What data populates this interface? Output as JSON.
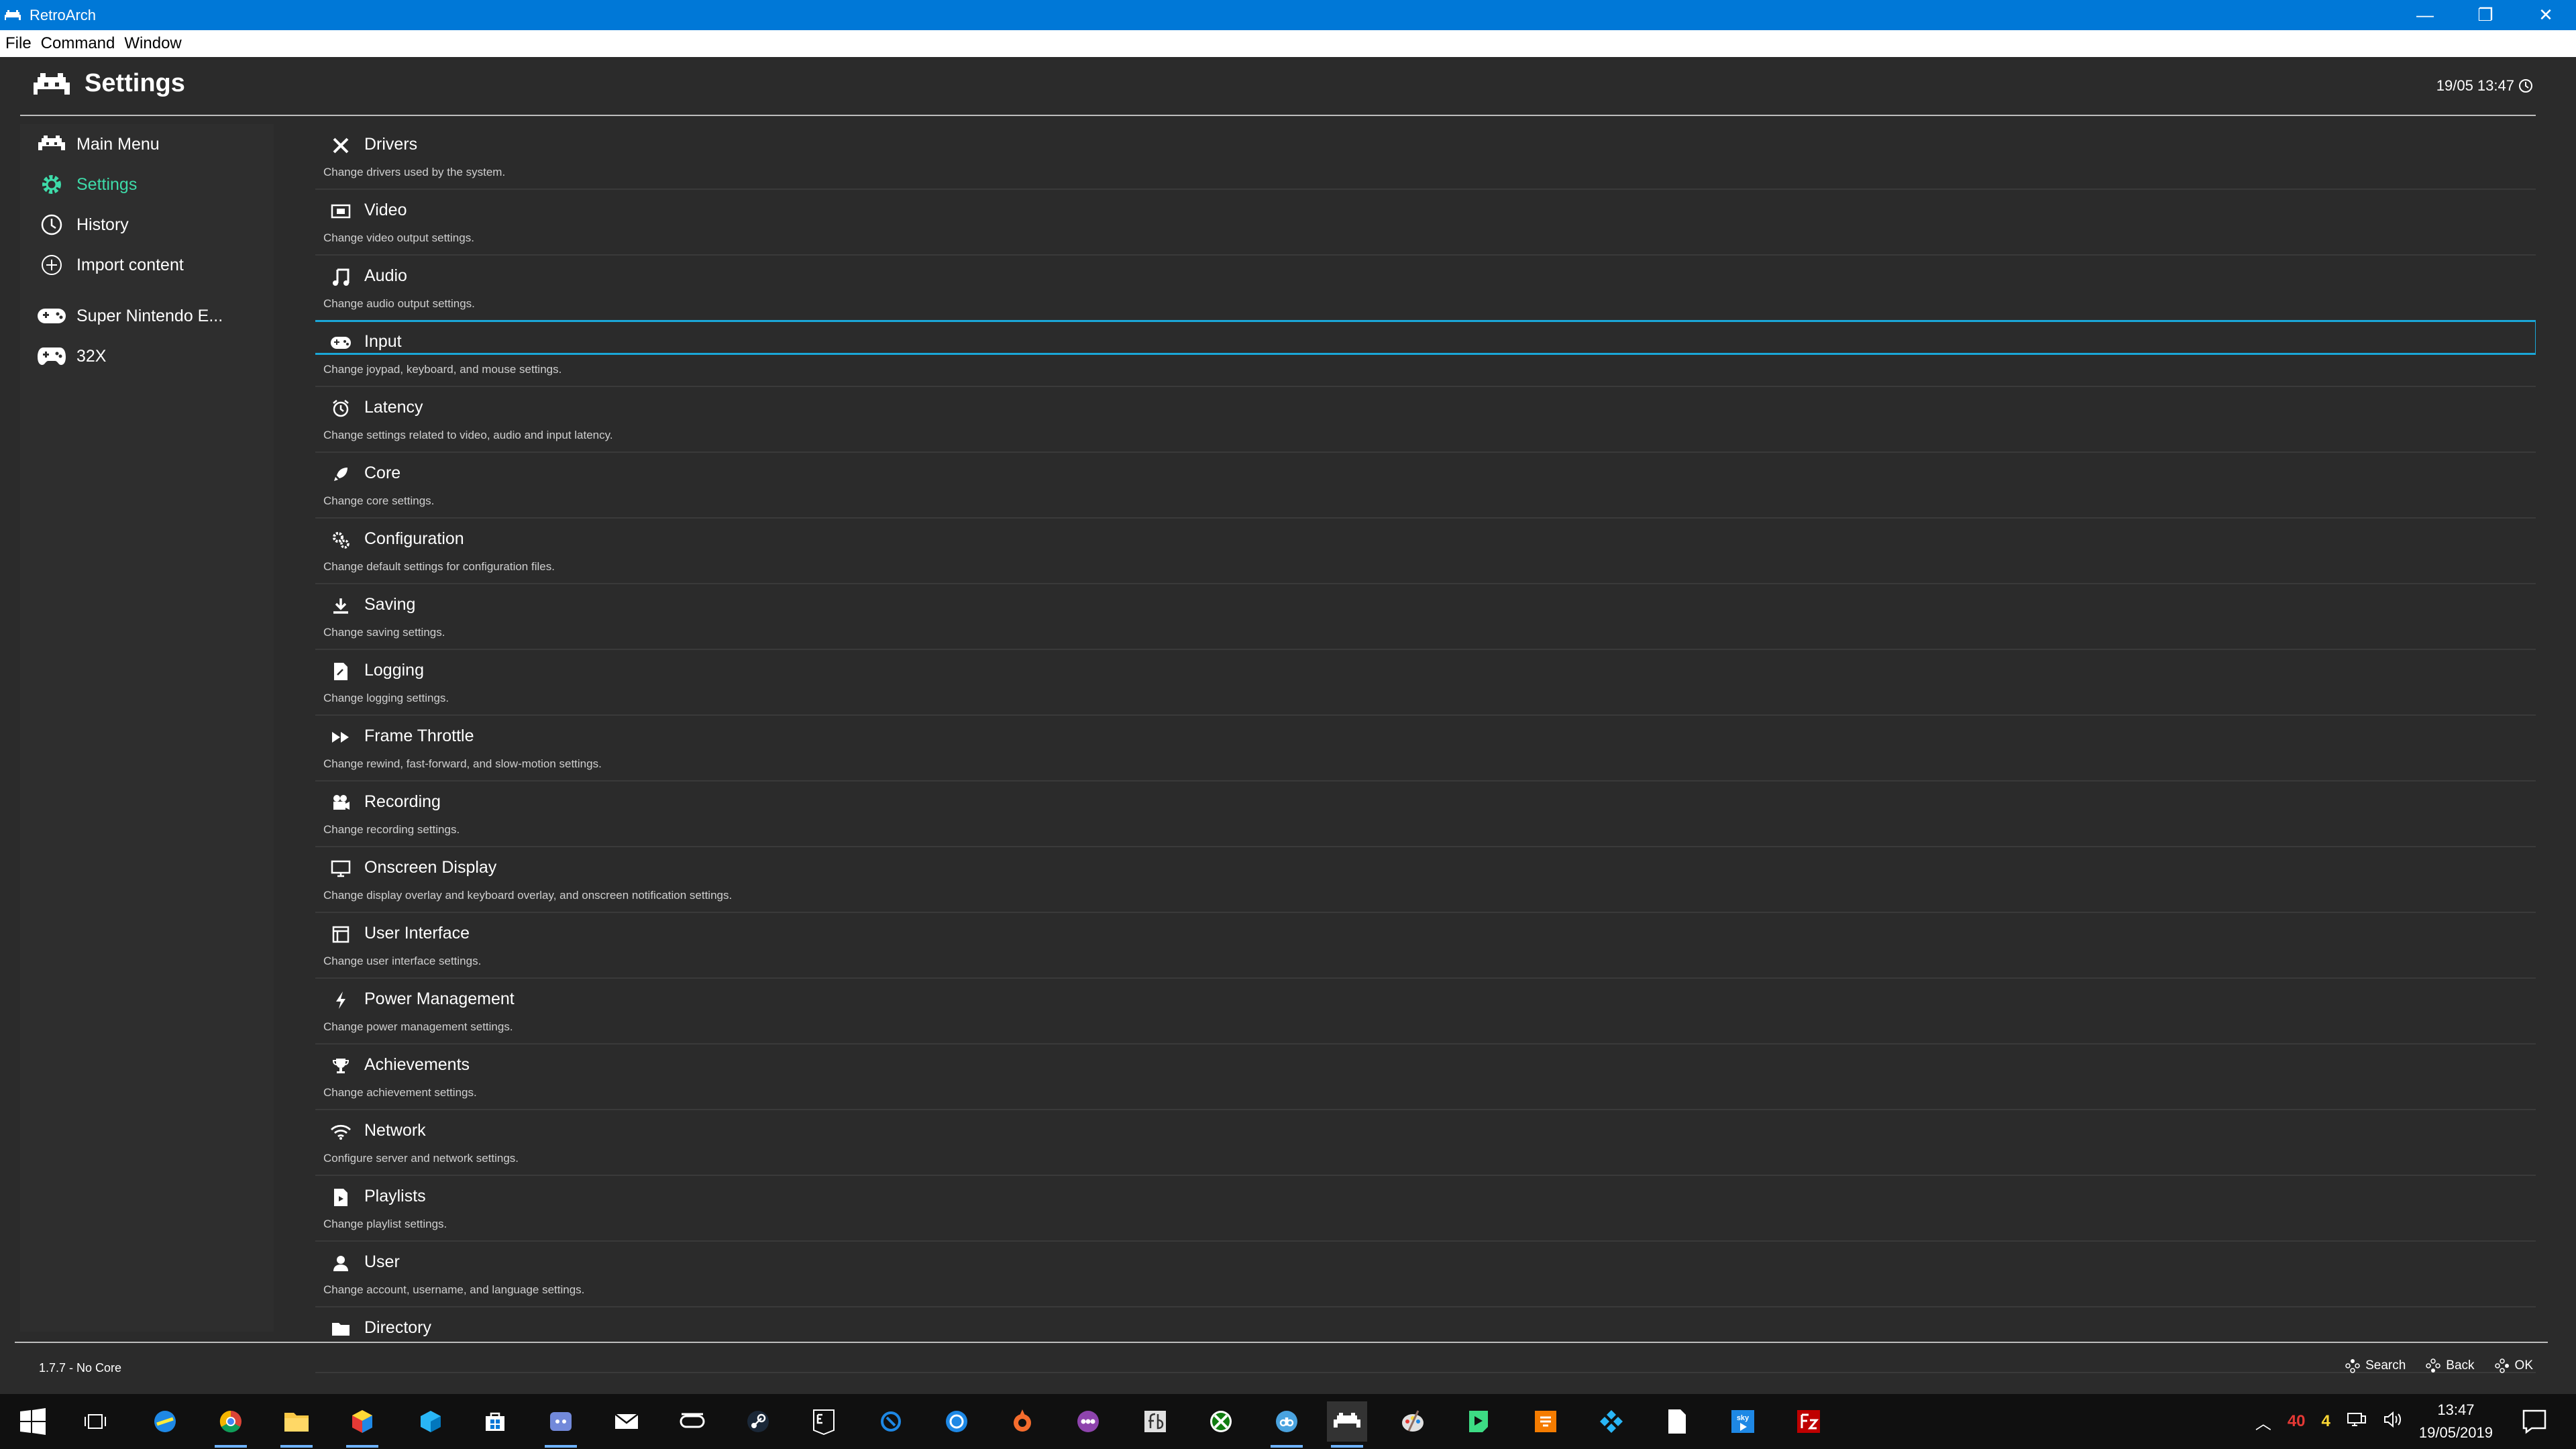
{
  "window": {
    "title": "RetroArch"
  },
  "menubar": {
    "items": [
      "File",
      "Command",
      "Window"
    ]
  },
  "header": {
    "title": "Settings",
    "datetime": "19/05 13:47"
  },
  "sidebar": {
    "items": [
      {
        "label": "Main Menu",
        "icon": "invader-icon"
      },
      {
        "label": "Settings",
        "icon": "gear-icon",
        "active": true
      },
      {
        "label": "History",
        "icon": "history-icon"
      },
      {
        "label": "Import content",
        "icon": "plus-circle-icon"
      },
      {
        "label": "Super Nintendo E...",
        "icon": "snes-controller-icon"
      },
      {
        "label": "32X",
        "icon": "gamepad-icon"
      }
    ]
  },
  "settings": {
    "items": [
      {
        "label": "Drivers",
        "desc": "Change drivers used by the system.",
        "icon": "tools-icon"
      },
      {
        "label": "Video",
        "desc": "Change video output settings.",
        "icon": "video-icon"
      },
      {
        "label": "Audio",
        "desc": "Change audio output settings.",
        "icon": "music-note-icon"
      },
      {
        "label": "Input",
        "desc": "Change joypad, keyboard, and mouse settings.",
        "icon": "gamepad-icon",
        "selected": true
      },
      {
        "label": "Latency",
        "desc": "Change settings related to video, audio and input latency.",
        "icon": "alarm-clock-icon"
      },
      {
        "label": "Core",
        "desc": "Change core settings.",
        "icon": "rocket-icon"
      },
      {
        "label": "Configuration",
        "desc": "Change default settings for configuration files.",
        "icon": "gears-icon"
      },
      {
        "label": "Saving",
        "desc": "Change saving settings.",
        "icon": "download-icon"
      },
      {
        "label": "Logging",
        "desc": "Change logging settings.",
        "icon": "log-file-icon"
      },
      {
        "label": "Frame Throttle",
        "desc": "Change rewind, fast-forward, and slow-motion settings.",
        "icon": "fast-forward-icon"
      },
      {
        "label": "Recording",
        "desc": "Change recording settings.",
        "icon": "camera-icon"
      },
      {
        "label": "Onscreen Display",
        "desc": "Change display overlay and keyboard overlay, and onscreen notification settings.",
        "icon": "monitor-icon"
      },
      {
        "label": "User Interface",
        "desc": "Change user interface settings.",
        "icon": "ui-window-icon"
      },
      {
        "label": "Power Management",
        "desc": "Change power management settings.",
        "icon": "lightning-icon"
      },
      {
        "label": "Achievements",
        "desc": "Change achievement settings.",
        "icon": "trophy-icon"
      },
      {
        "label": "Network",
        "desc": "Configure server and network settings.",
        "icon": "wifi-icon"
      },
      {
        "label": "Playlists",
        "desc": "Change playlist settings.",
        "icon": "playlist-file-icon"
      },
      {
        "label": "User",
        "desc": "Change account, username, and language settings.",
        "icon": "user-icon"
      },
      {
        "label": "Directory",
        "desc": "",
        "icon": "folder-icon"
      }
    ]
  },
  "footer": {
    "version": "1.7.7 - No Core",
    "hints": [
      "Search",
      "Back",
      "OK"
    ]
  },
  "taskbar": {
    "tray_counter_red": "40",
    "tray_counter_yellow": "4",
    "time": "13:47",
    "date": "19/05/2019",
    "colors": {
      "accent": "#0078d7",
      "active_green": "#3edba9",
      "selection_blue": "#1aa7d8"
    }
  }
}
